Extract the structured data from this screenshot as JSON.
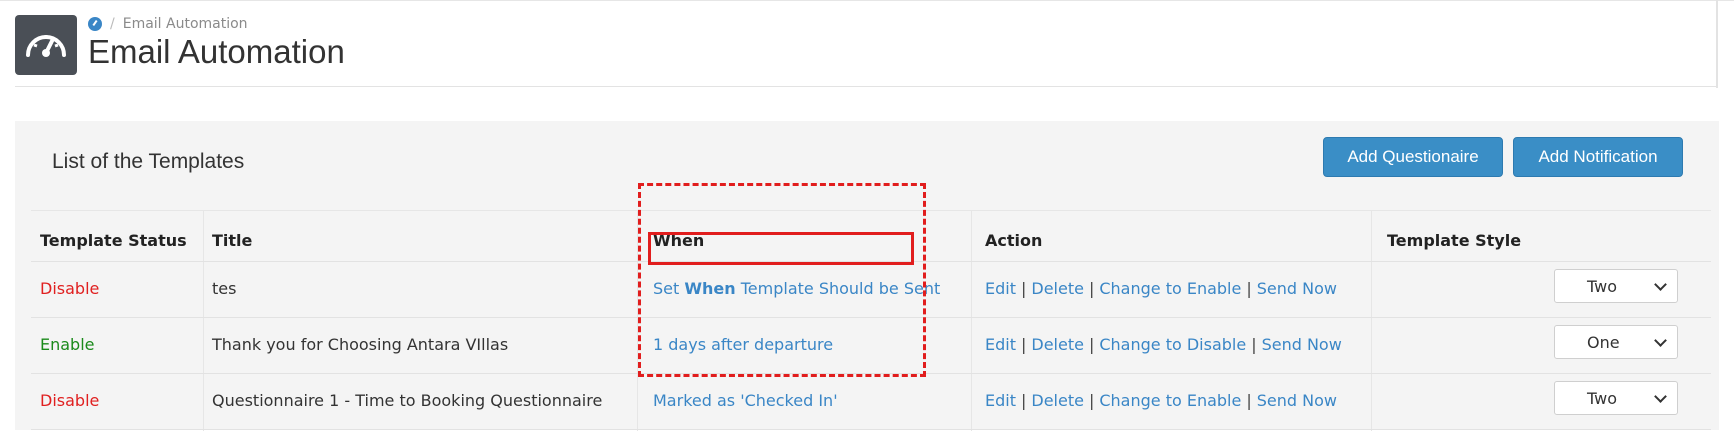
{
  "breadcrumb": {
    "current": "Email Automation"
  },
  "page": {
    "title": "Email Automation"
  },
  "panel": {
    "title": "List of the Templates",
    "buttons": {
      "add_questionaire": "Add Questionaire",
      "add_notification": "Add Notification"
    }
  },
  "table": {
    "headers": {
      "status": "Template Status",
      "title": "Title",
      "when": "When",
      "action": "Action",
      "style": "Template Style"
    },
    "rows": [
      {
        "status": "Disable",
        "title": "tes",
        "when_prefix": "Set ",
        "when_bold": "When",
        "when_suffix": " Template Should be Sent",
        "actions": {
          "edit": "Edit",
          "delete": "Delete",
          "toggle": "Change to Enable",
          "send": "Send Now"
        },
        "style": "Two"
      },
      {
        "status": "Enable",
        "title": "Thank you for Choosing Antara VIllas",
        "when": "1 days after departure",
        "actions": {
          "edit": "Edit",
          "delete": "Delete",
          "toggle": "Change to Disable",
          "send": "Send Now"
        },
        "style": "One"
      },
      {
        "status": "Disable",
        "title": "Questionnaire 1 - Time to Booking Questionnaire",
        "when": "Marked as 'Checked In'",
        "actions": {
          "edit": "Edit",
          "delete": "Delete",
          "toggle": "Change to Enable",
          "send": "Send Now"
        },
        "style": "Two"
      }
    ],
    "separator": "|"
  },
  "colors": {
    "accent": "#3a86c6",
    "button": "#3a8ec6",
    "disable": "#e02020",
    "enable": "#1a8a1a",
    "highlight": "#e11d1d"
  }
}
